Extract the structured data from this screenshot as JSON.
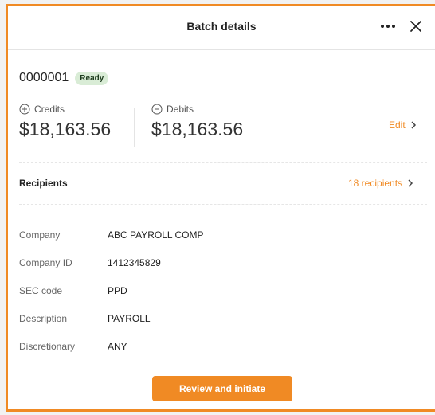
{
  "header": {
    "title": "Batch details",
    "more_icon": "more-horizontal-icon",
    "close_icon": "close-icon"
  },
  "batch": {
    "id": "0000001",
    "status": "Ready",
    "status_color": "#d9ecd6"
  },
  "credits": {
    "icon": "plus-circle-icon",
    "label": "Credits",
    "amount": "$18,163.56"
  },
  "debits": {
    "icon": "minus-circle-icon",
    "label": "Debits",
    "amount": "$18,163.56"
  },
  "edit": {
    "label": "Edit",
    "icon": "chevron-right-icon"
  },
  "recipients": {
    "label": "Recipients",
    "link": "18 recipients",
    "icon": "chevron-right-icon"
  },
  "details": [
    {
      "label": "Company",
      "value": "ABC PAYROLL COMP"
    },
    {
      "label": "Company ID",
      "value": "1412345829"
    },
    {
      "label": "SEC code",
      "value": "PPD"
    },
    {
      "label": "Description",
      "value": "PAYROLL"
    },
    {
      "label": "Discretionary",
      "value": "ANY"
    }
  ],
  "action": {
    "label": "Review and initiate"
  },
  "colors": {
    "accent": "#f08a24",
    "badge_bg": "#d9ecd6"
  }
}
